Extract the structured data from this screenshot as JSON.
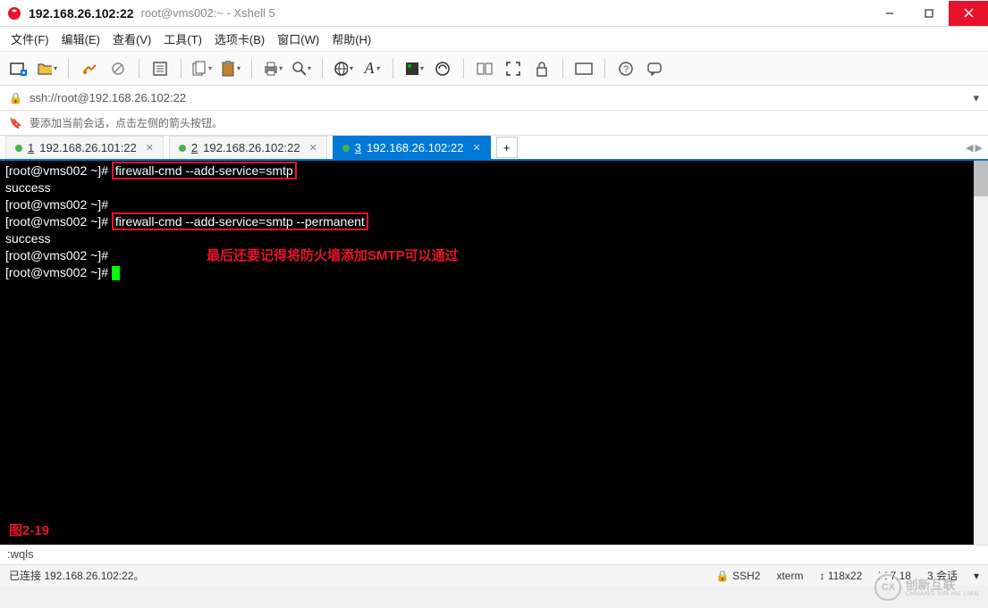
{
  "window": {
    "title": "192.168.26.102:22",
    "subtitle": "root@vms002:~ - Xshell 5"
  },
  "menu": {
    "file": "文件(F)",
    "edit": "编辑(E)",
    "view": "查看(V)",
    "tools": "工具(T)",
    "tabs": "选项卡(B)",
    "window": "窗口(W)",
    "help": "帮助(H)"
  },
  "address": {
    "url": "ssh://root@192.168.26.102:22"
  },
  "infobar": {
    "text": "要添加当前会话，点击左侧的箭头按钮。"
  },
  "tabs": [
    {
      "num": "1",
      "label": "192.168.26.101:22",
      "active": false
    },
    {
      "num": "2",
      "label": "192.168.26.102:22",
      "active": false
    },
    {
      "num": "3",
      "label": "192.168.26.102:22",
      "active": true
    }
  ],
  "terminal": {
    "line1_prompt": "[root@vms002 ~]# ",
    "line1_cmd": "firewall-cmd --add-service=smtp",
    "line2": "success",
    "line3": "[root@vms002 ~]#",
    "line4_prompt": "[root@vms002 ~]# ",
    "line4_cmd": "firewall-cmd --add-service=smtp --permanent",
    "line5": "success",
    "line6": "[root@vms002 ~]#",
    "note": "最后还要记得将防火墙添加SMTP可以通过",
    "line7": "[root@vms002 ~]# ",
    "figure": "图2-19"
  },
  "inputbar": {
    "text": ":wqls"
  },
  "status": {
    "left": "已连接 192.168.26.102:22。",
    "ssh": "SSH2",
    "term": "xterm",
    "size": "118x22",
    "pos": "7,18",
    "sessions": "3 会话"
  },
  "watermark": {
    "cn": "创新互联",
    "en": "CHUANG XIN HU LIAN"
  }
}
